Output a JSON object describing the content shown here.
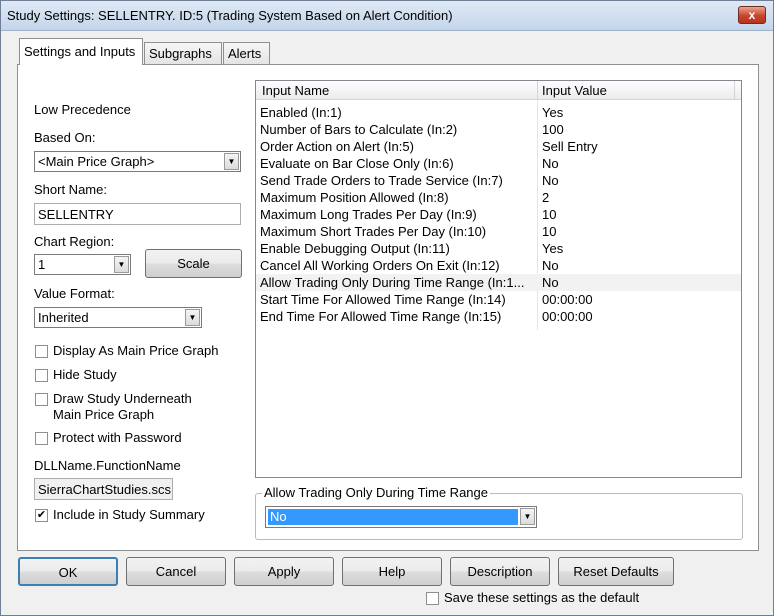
{
  "window": {
    "title": "Study Settings: SELLENTRY. ID:5 (Trading System Based on Alert Condition)",
    "close_glyph": "x"
  },
  "tabs": [
    {
      "label": "Settings and Inputs",
      "active": true
    },
    {
      "label": "Subgraphs",
      "active": false
    },
    {
      "label": "Alerts",
      "active": false
    }
  ],
  "left": {
    "precedence": "Low Precedence",
    "based_on_label": "Based On:",
    "based_on_value": "<Main Price Graph>",
    "short_name_label": "Short Name:",
    "short_name_value": "SELLENTRY",
    "chart_region_label": "Chart Region:",
    "chart_region_value": "1",
    "scale_button": "Scale",
    "value_format_label": "Value Format:",
    "value_format_value": "Inherited",
    "checkboxes": [
      {
        "label": "Display As Main Price Graph",
        "checked": false
      },
      {
        "label": "Hide Study",
        "checked": false
      },
      {
        "label": "Draw Study Underneath",
        "label2": "Main Price Graph",
        "checked": false
      },
      {
        "label": "Protect with Password",
        "checked": false
      }
    ],
    "dll_label": "DLLName.FunctionName",
    "dll_value": "SierraChartStudies.scs",
    "include_summary": {
      "label": "Include in Study Summary",
      "checked": true
    }
  },
  "grid": {
    "col_name": "Input Name",
    "col_value": "Input Value",
    "rows": [
      {
        "name": "Enabled   (In:1)",
        "value": "Yes"
      },
      {
        "name": "Number of Bars to Calculate   (In:2)",
        "value": "100"
      },
      {
        "name": "Order Action on Alert   (In:5)",
        "value": "Sell Entry"
      },
      {
        "name": "Evaluate on Bar Close Only   (In:6)",
        "value": "No"
      },
      {
        "name": "Send Trade Orders to Trade Service   (In:7)",
        "value": "No"
      },
      {
        "name": "Maximum Position Allowed   (In:8)",
        "value": "2"
      },
      {
        "name": "Maximum Long Trades Per Day   (In:9)",
        "value": "10"
      },
      {
        "name": "Maximum Short Trades Per Day   (In:10)",
        "value": "10"
      },
      {
        "name": "Enable Debugging Output   (In:11)",
        "value": "Yes"
      },
      {
        "name": "Cancel All Working Orders On Exit   (In:12)",
        "value": "No"
      },
      {
        "name": "Allow Trading Only During Time Range   (In:1...",
        "value": "No",
        "selected": true
      },
      {
        "name": "Start Time For Allowed Time Range   (In:14)",
        "value": "00:00:00"
      },
      {
        "name": "End Time For Allowed Time Range   (In:15)",
        "value": "00:00:00"
      }
    ]
  },
  "editor": {
    "legend": "Allow Trading Only During Time Range",
    "value": "No"
  },
  "buttons": {
    "ok": "OK",
    "cancel": "Cancel",
    "apply": "Apply",
    "help": "Help",
    "description": "Description",
    "reset": "Reset Defaults"
  },
  "save_default": {
    "label": "Save these settings as the default",
    "checked": false
  },
  "colors": {
    "selection": "#3399ff",
    "titlebar": "#c4d5ea"
  }
}
